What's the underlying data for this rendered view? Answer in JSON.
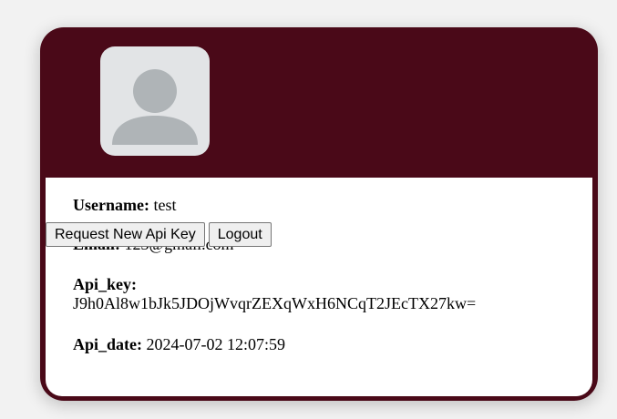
{
  "profile": {
    "username_label": "Username:",
    "username": "test",
    "email_label": "Email:",
    "email": "123@gmail.com",
    "api_key_label": "Api_key:",
    "api_key": "J9h0Al8w1bJk5JDOjWvqrZEXqWxH6NCqT2JEcTX27kw=",
    "api_date_label": "Api_date:",
    "api_date": "2024-07-02 12:07:59"
  },
  "actions": {
    "request_key_label": "Request New Api Key",
    "logout_label": "Logout"
  },
  "avatar": {
    "icon": "user-silhouette-icon"
  },
  "colors": {
    "card_background": "#4a0918",
    "panel_background": "#ffffff",
    "avatar_background": "#e2e4e6",
    "avatar_figure": "#afb4b7"
  }
}
